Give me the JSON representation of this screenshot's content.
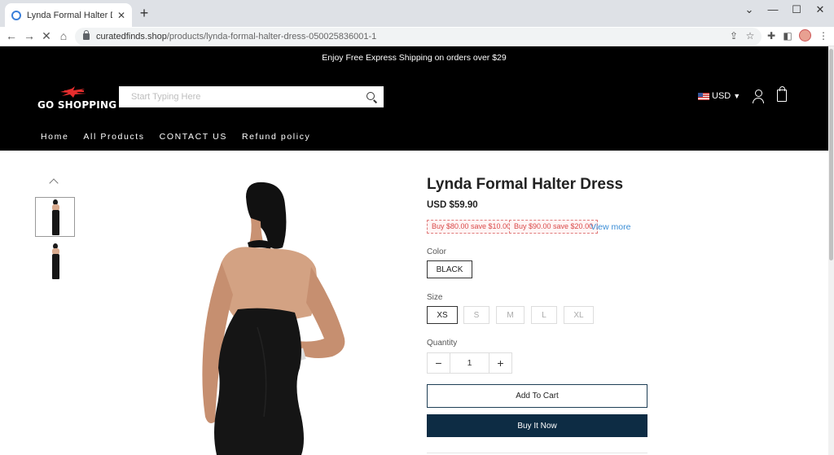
{
  "browser": {
    "tab_title": "Lynda Formal Halter Dress - acto",
    "tab_close": "✕",
    "new_tab": "+",
    "url_domain": "curatedfinds.shop",
    "url_path": "/products/lynda-formal-halter-dress-050025836001-1",
    "controls": {
      "minimize": "—",
      "maximize": "☐",
      "close": "✕",
      "dropdown": "⌄"
    },
    "nav": {
      "back": "←",
      "forward": "→",
      "reload": "✕",
      "home": "⌂"
    },
    "toolbar_icons": [
      "share-icon",
      "star-icon",
      "extensions-icon",
      "sidebar-icon",
      "profile-avatar",
      "menu-icon"
    ]
  },
  "announcement": "Enjoy Free Express Shipping on orders over $29",
  "header": {
    "logo_text": "GO  SHOPPING",
    "search_placeholder": "Start Typing Here",
    "currency": "USD",
    "nav": [
      "Home",
      "All Products",
      "CONTACT US",
      "Refund policy"
    ]
  },
  "product": {
    "title": "Lynda Formal Halter Dress",
    "price": "USD $59.90",
    "promos": [
      "Buy $80.00 save $10.00",
      "Buy $90.00 save $20.00"
    ],
    "view_more": "View more",
    "color_label": "Color",
    "colors": [
      "BLACK"
    ],
    "selected_color": "BLACK",
    "size_label": "Size",
    "sizes": [
      "XS",
      "S",
      "M",
      "L",
      "XL"
    ],
    "selected_size": "XS",
    "quantity_label": "Quantity",
    "quantity": "1",
    "qty_minus": "−",
    "qty_plus": "+",
    "add_to_cart": "Add To Cart",
    "buy_now": "Buy It Now"
  },
  "colors": {
    "header_bg": "#000000",
    "promo_red": "#d94848",
    "link_blue": "#3a8dd6",
    "buy_now_bg": "#0d2c44"
  }
}
